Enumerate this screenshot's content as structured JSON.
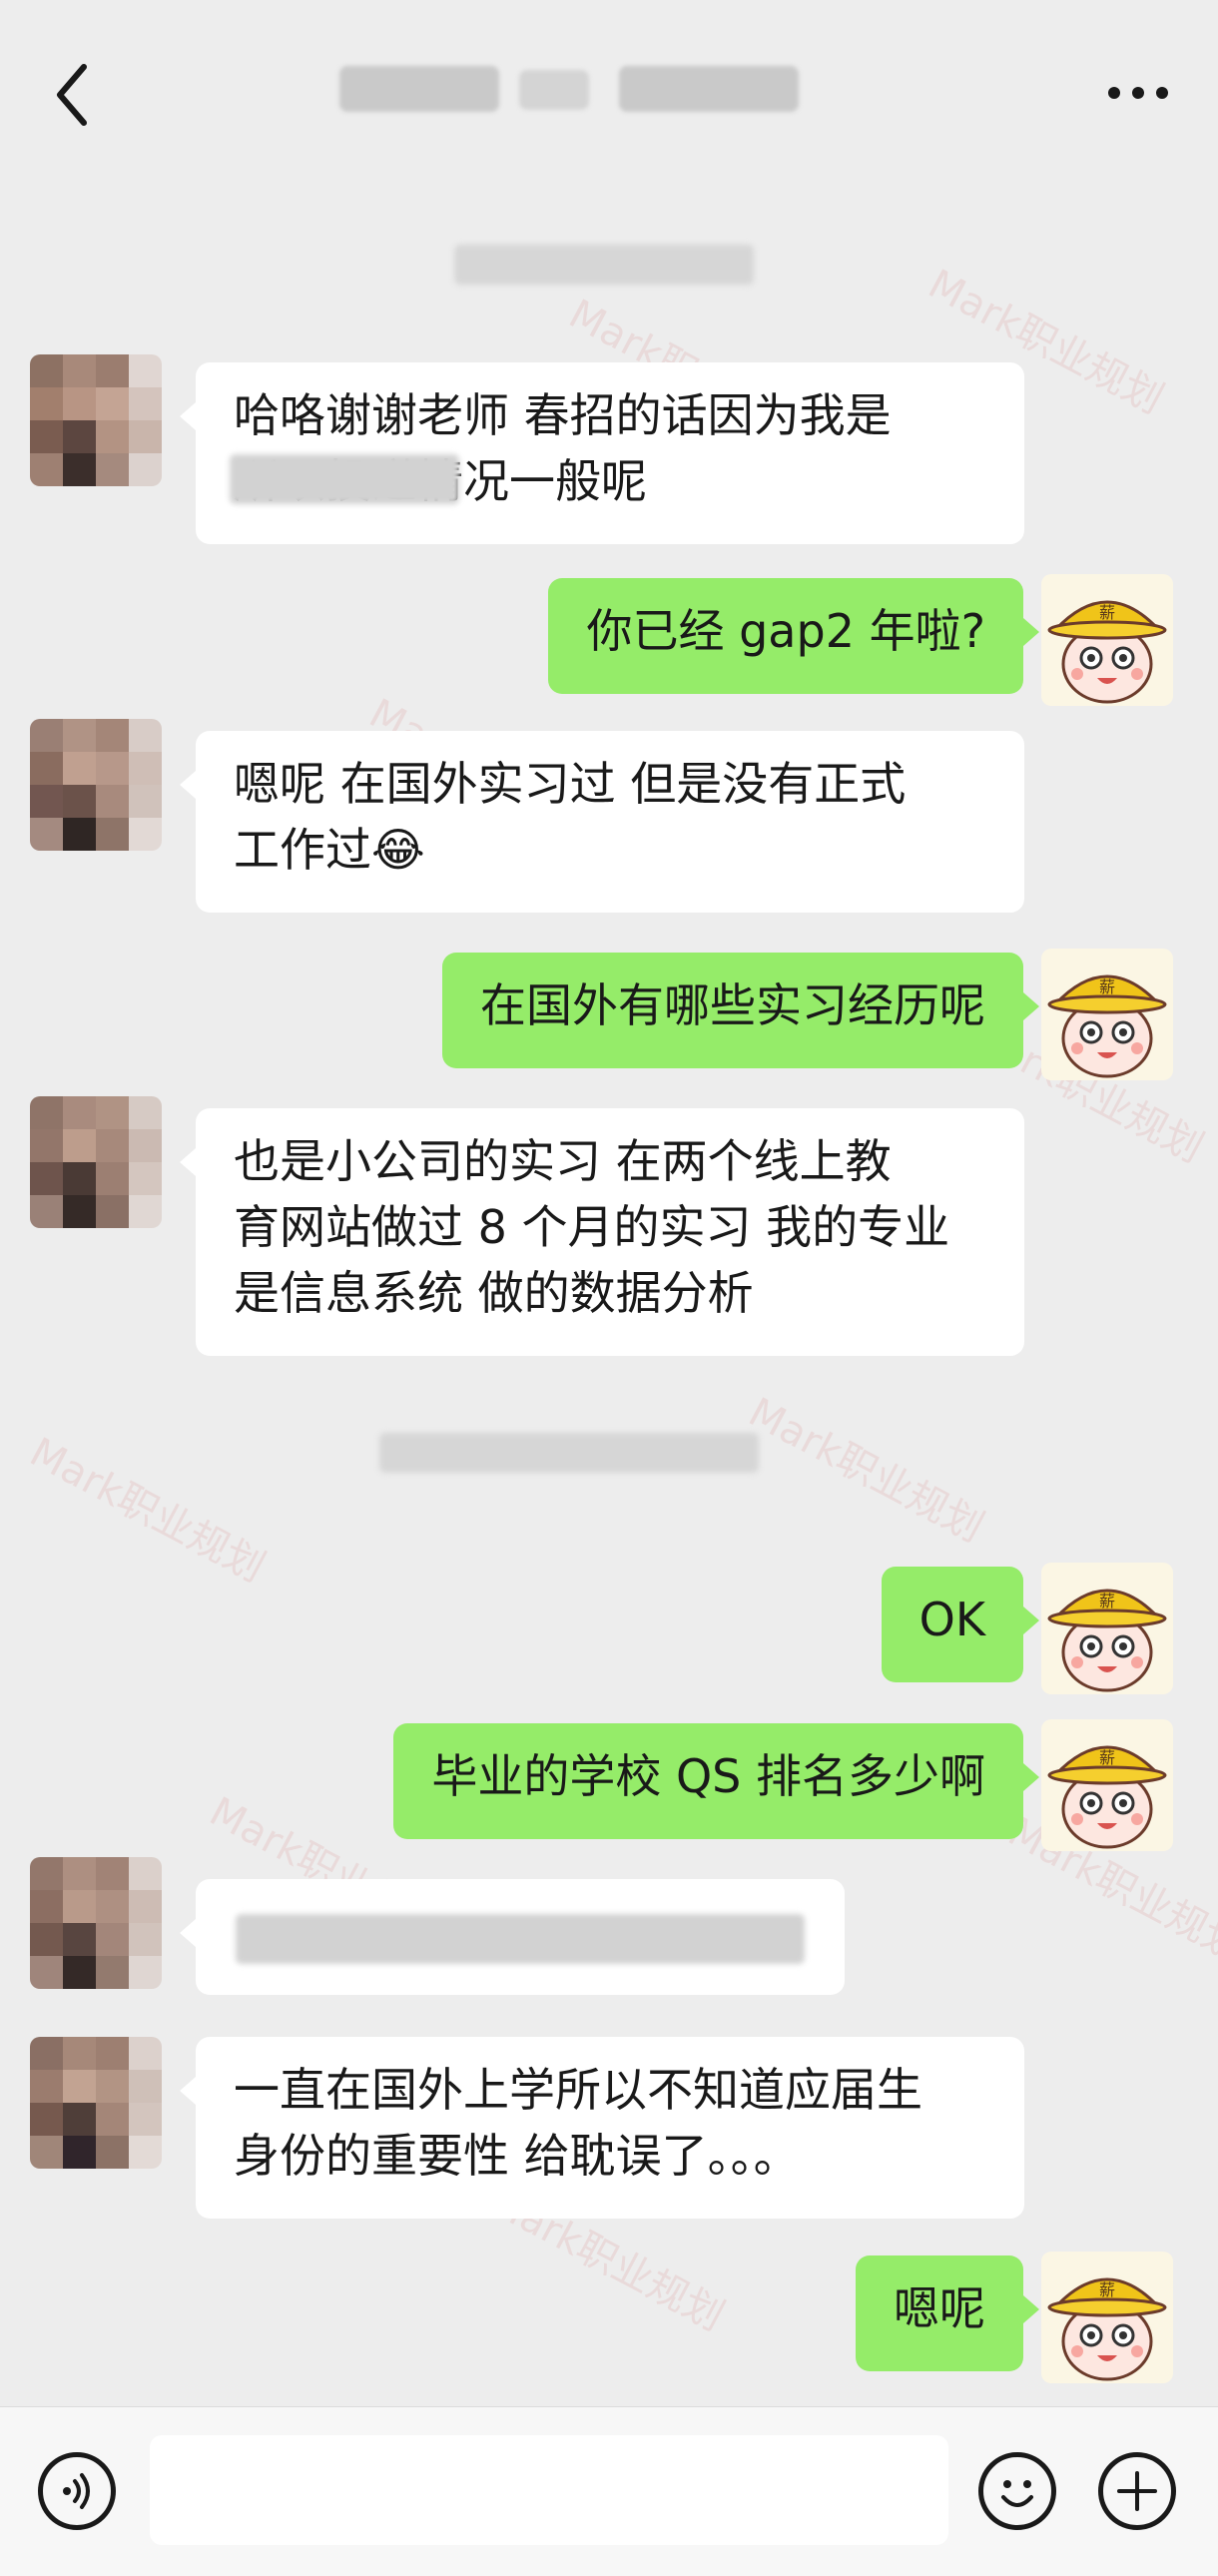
{
  "header": {
    "back_label": "‹",
    "more_label": "···"
  },
  "messages": [
    {
      "side": "left",
      "text": "哈咯谢谢老师 春招的话因为我是\n所以投递情况一般呢"
    },
    {
      "side": "right",
      "text": "你已经 gap2 年啦?"
    },
    {
      "side": "left",
      "text": "嗯呢 在国外实习过 但是没有正式\n工作过😂"
    },
    {
      "side": "right",
      "text": "在国外有哪些实习经历呢"
    },
    {
      "side": "left",
      "text": "也是小公司的实习 在两个线上教\n育网站做过 8 个月的实习 我的专业\n是信息系统 做的数据分析"
    },
    {
      "side": "right",
      "text": "OK"
    },
    {
      "side": "right",
      "text": "毕业的学校 QS 排名多少啊"
    },
    {
      "side": "left",
      "text": ""
    },
    {
      "side": "left",
      "text": "一直在国外上学所以不知道应届生\n身份的重要性 给耽误了。。。"
    },
    {
      "side": "right",
      "text": "嗯呢"
    }
  ],
  "avatar_right": {
    "badge": "薪",
    "hat_color": "#f0c419"
  },
  "watermark": "Mark职业规划",
  "colors": {
    "background": "#ededed",
    "self_bubble": "#95ec69",
    "other_bubble": "#ffffff"
  },
  "icons": {
    "voice": "voice-icon",
    "emoji": "emoji-icon",
    "plus": "plus-icon",
    "back": "back-icon",
    "more": "more-icon"
  }
}
